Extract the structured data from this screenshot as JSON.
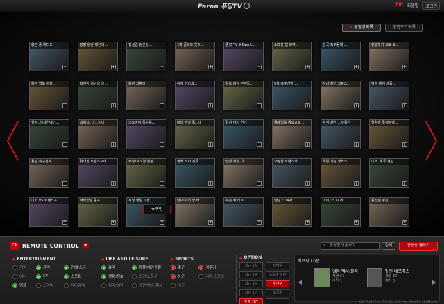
{
  "header": {
    "logo": "Paran 푸딩TV",
    "fip": "FIP",
    "links": [
      "도움말",
      "로그인"
    ]
  },
  "tabs": [
    {
      "label": "동영상목록",
      "active": true
    },
    {
      "label": "장면토크목록",
      "active": false
    }
  ],
  "tooltip": "쇼구민",
  "thumbnails": [
    [
      "용관 중 비디오",
      "정평 용관 대전의...",
      "정설업 팅신발...",
      "1마 금르트 맛으...",
      "중앙 TV 9 Event...",
      "소래한 법 보여...",
      "한국 축구동해 ...",
      "유행하기 요요 요.."
    ],
    [
      "용관 업모 수포...",
      "회현정 경년을 올...",
      "용관 고향이",
      "이겨 하이바...",
      "유도 빠딩 관객들...",
      "9월 축구선발 ...",
      "삭서 정년 그림스...",
      "여성 앵커 성동..."
    ],
    [
      "열정..생자연예인...",
      "빅뱅 소 마...이미",
      "오토바이 목수를...",
      "미리 엔딩 목...이",
      "갈이 아지 연기",
      "동쇄법를 동외교로 ..",
      "서식 차반 ...부룩한",
      "열람판 목성필렉..."
    ],
    [
      "용관 축구전재...",
      "위대한 트랜스포머...",
      "푸딩TV 9월 열정..",
      "영화 300 진투...",
      "당황 적한 나...",
      "오정한 트랜스와...",
      "해릴 기는 영화스...",
      "미쇼 대 쪽 열린..."
    ],
    [
      "디저 VS 트랜스포...",
      "매력없님 공포...",
      "시딩 생일 이상..",
      "만보이 어 생 바...",
      "북쑛 내 비르...",
      "발달 타 여자 그..",
      "어이, 터 시 꺼...",
      "동전짐 영진..."
    ]
  ],
  "remote": {
    "badge": "Ch",
    "title": "REMOTE CONTROL",
    "search_placeholder": "장영한 방송사고",
    "search_label": "검색",
    "upload_label": "동영상 올리기"
  },
  "categories": [
    {
      "title": "ENTERTAINMENT",
      "items": [
        {
          "label": "게임",
          "state": "off"
        },
        {
          "label": "음악",
          "state": "on"
        },
        {
          "label": "연예/스타",
          "state": "on"
        },
        {
          "label": "애니",
          "state": "off"
        },
        {
          "label": "CF",
          "state": "on"
        },
        {
          "label": "스포트",
          "state": "on"
        },
        {
          "label": "영화",
          "state": "on"
        },
        {
          "label": "드라마",
          "state": "off"
        },
        {
          "label": "레미임쳐",
          "state": "off"
        }
      ]
    },
    {
      "title": "LIFE AND LEISURE",
      "items": [
        {
          "label": "유머",
          "state": "on"
        },
        {
          "label": "동물/애완동물",
          "state": "on"
        },
        {
          "label": "생활/정보",
          "state": "on"
        },
        {
          "label": "엽기/노하우",
          "state": "off"
        },
        {
          "label": "취미/여행",
          "state": "off"
        },
        {
          "label": "공연/방송/행사",
          "state": "off"
        }
      ]
    },
    {
      "title": "SPORTS",
      "items": [
        {
          "label": "축구",
          "state": "red"
        },
        {
          "label": "격투기",
          "state": "red"
        },
        {
          "label": "농구",
          "state": "red"
        },
        {
          "label": "기타 스포츠",
          "state": "off"
        },
        {
          "label": "야구",
          "state": "off"
        }
      ]
    }
  ],
  "option": {
    "title": "OPTION",
    "buttons": [
      {
        "label": "최근 1일",
        "selected": false
      },
      {
        "label": "재생순",
        "selected": false
      },
      {
        "label": "최근 1주",
        "selected": false
      },
      {
        "label": "조회가 많은",
        "selected": false
      },
      {
        "label": "최근 1달",
        "selected": false
      },
      {
        "label": "추천순",
        "selected": true
      },
      {
        "label": "최근 1년",
        "selected": false
      },
      {
        "label": "댓글순",
        "selected": false
      },
      {
        "label": "전체 기간",
        "selected": true
      },
      {
        "label": "",
        "selected": false
      }
    ]
  },
  "top10": {
    "title": "최고의 10분",
    "items": [
      {
        "title": "일본 택시 불러",
        "plays": "재생 34",
        "recs": "추천 1"
      },
      {
        "title": "빌린 테르리스",
        "plays": "재생 30",
        "recs": "추천 0"
      }
    ]
  },
  "copyright": "COPYRIGHT © KTH CO., LTD. ALL RIGHTS RESERVED."
}
